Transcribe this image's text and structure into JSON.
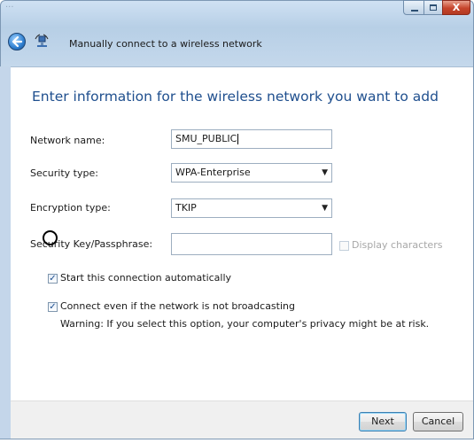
{
  "window": {
    "title_ghost": "...",
    "caption_buttons": {
      "minimize": "",
      "maximize": "",
      "close": "X"
    }
  },
  "header": {
    "back_icon": "back-arrow-icon",
    "network_icon": "wireless-network-icon",
    "title": "Manually connect to a wireless network"
  },
  "main": {
    "instruction": "Enter information for the wireless network you want to add",
    "network_name": {
      "label": "Network name:",
      "value": "SMU_PUBLIC"
    },
    "security_type": {
      "label": "Security type:",
      "value": "WPA-Enterprise"
    },
    "encryption_type": {
      "label": "Encryption type:",
      "value": "TKIP"
    },
    "security_key": {
      "label": "Security Key/Passphrase:",
      "value": "",
      "display_characters_label": "Display characters",
      "display_characters_checked": false
    },
    "start_automatically": {
      "label": "Start this connection automatically",
      "checked": true
    },
    "connect_not_broadcasting": {
      "label": "Connect even if the network is not broadcasting",
      "checked": true
    },
    "warning": "Warning: If you select this option, your computer's privacy might be at risk."
  },
  "footer": {
    "next_label": "Next",
    "cancel_label": "Cancel"
  },
  "colors": {
    "instruction_text": "#1f4f8e",
    "frame": "#b7cfe6",
    "close_button": "#c6452c"
  }
}
